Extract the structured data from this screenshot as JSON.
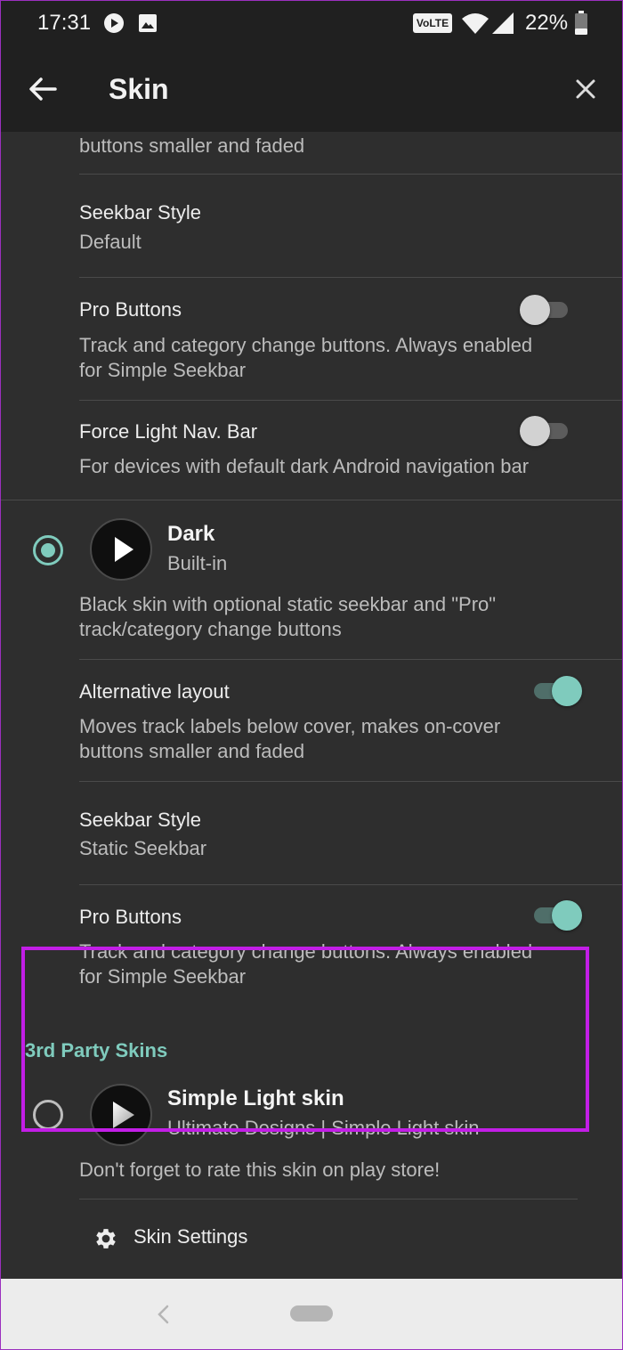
{
  "status_bar": {
    "time": "17:31",
    "volte": "VoLTE",
    "battery": "22%",
    "icons": [
      "play-icon",
      "image-icon",
      "volte-icon",
      "wifi-icon",
      "signal-icon",
      "battery-icon"
    ]
  },
  "app_bar": {
    "title": "Skin"
  },
  "previous_skin": {
    "alt_layout_tail": "buttons smaller and faded",
    "seekbar_style": {
      "title": "Seekbar Style",
      "value": "Default"
    },
    "pro_buttons": {
      "title": "Pro Buttons",
      "desc1": "Track and category change buttons. Always enabled",
      "desc2": "for Simple Seekbar",
      "enabled": false
    },
    "force_light_nav": {
      "title": "Force Light Nav. Bar",
      "desc": "For devices with default dark Android navigation bar",
      "enabled": false
    }
  },
  "dark_skin": {
    "name": "Dark",
    "source": "Built-in",
    "selected": true,
    "desc1": "Black skin with optional static seekbar and \"Pro\"",
    "desc2": "track/category change buttons",
    "alt_layout": {
      "title": "Alternative layout",
      "desc1": "Moves track labels below cover, makes on-cover",
      "desc2": "buttons smaller and faded",
      "enabled": true
    },
    "seekbar_style": {
      "title": "Seekbar Style",
      "value": "Static Seekbar"
    },
    "pro_buttons": {
      "title": "Pro Buttons",
      "desc1": "Track and category change buttons. Always enabled",
      "desc2": "for Simple Seekbar",
      "enabled": true
    }
  },
  "third_party": {
    "header": "3rd Party Skins",
    "skin": {
      "name": "Simple Light skin",
      "source": "Ultimate Designs | Simple Light skin",
      "selected": false,
      "desc": "Don't forget to rate this skin on play store!",
      "settings_label": "Skin Settings"
    }
  },
  "colors": {
    "accent": "#7fcbbd",
    "highlight": "#c21ee6",
    "background": "#2e2e2e",
    "bar": "#202020"
  }
}
